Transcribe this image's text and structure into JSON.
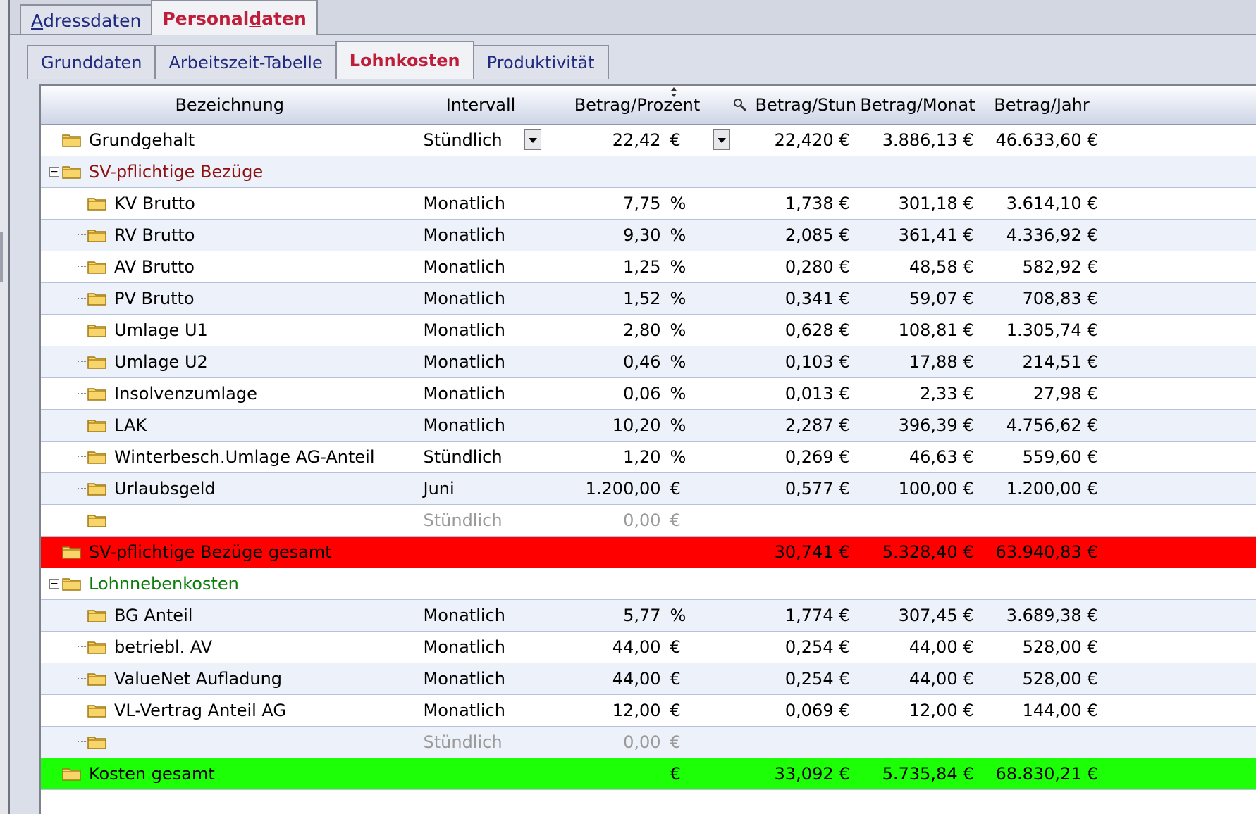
{
  "tabs_top": [
    {
      "pre": "",
      "ul": "A",
      "post": "dressdaten"
    },
    {
      "pre": "Personal",
      "ul": "d",
      "post": "aten"
    }
  ],
  "tabs_sub": [
    "Grunddaten",
    "Arbeitszeit-Tabelle",
    "Lohnkosten",
    "Produktivität"
  ],
  "columns": [
    "Bezeichnung",
    "Intervall",
    "Betrag/Prozent",
    "Betrag/Stunde",
    "Betrag/Monat",
    "Betrag/Jahr"
  ],
  "rows": [
    {
      "name": "Grundgehalt",
      "interval": "Stündlich",
      "amount": "22,42",
      "unit": "€",
      "hour": "22,420 €",
      "month": "3.886,13 €",
      "year": "46.633,60 €"
    },
    {
      "name": "SV-pflichtige Bezüge",
      "interval": "",
      "amount": "",
      "unit": "",
      "hour": "",
      "month": "",
      "year": ""
    },
    {
      "name": "KV Brutto",
      "interval": "Monatlich",
      "amount": "7,75",
      "unit": "%",
      "hour": "1,738 €",
      "month": "301,18 €",
      "year": "3.614,10 €"
    },
    {
      "name": "RV Brutto",
      "interval": "Monatlich",
      "amount": "9,30",
      "unit": "%",
      "hour": "2,085 €",
      "month": "361,41 €",
      "year": "4.336,92 €"
    },
    {
      "name": "AV Brutto",
      "interval": "Monatlich",
      "amount": "1,25",
      "unit": "%",
      "hour": "0,280 €",
      "month": "48,58 €",
      "year": "582,92 €"
    },
    {
      "name": "PV Brutto",
      "interval": "Monatlich",
      "amount": "1,52",
      "unit": "%",
      "hour": "0,341 €",
      "month": "59,07 €",
      "year": "708,83 €"
    },
    {
      "name": "Umlage U1",
      "interval": "Monatlich",
      "amount": "2,80",
      "unit": "%",
      "hour": "0,628 €",
      "month": "108,81 €",
      "year": "1.305,74 €"
    },
    {
      "name": "Umlage U2",
      "interval": "Monatlich",
      "amount": "0,46",
      "unit": "%",
      "hour": "0,103 €",
      "month": "17,88 €",
      "year": "214,51 €"
    },
    {
      "name": "Insolvenzumlage",
      "interval": "Monatlich",
      "amount": "0,06",
      "unit": "%",
      "hour": "0,013 €",
      "month": "2,33 €",
      "year": "27,98 €"
    },
    {
      "name": "LAK",
      "interval": "Monatlich",
      "amount": "10,20",
      "unit": "%",
      "hour": "2,287 €",
      "month": "396,39 €",
      "year": "4.756,62 €"
    },
    {
      "name": "Winterbesch.Umlage AG-Anteil",
      "interval": "Stündlich",
      "amount": "1,20",
      "unit": "%",
      "hour": "0,269 €",
      "month": "46,63 €",
      "year": "559,60 €"
    },
    {
      "name": "Urlaubsgeld",
      "interval": "Juni",
      "amount": "1.200,00",
      "unit": "€",
      "hour": "0,577 €",
      "month": "100,00 €",
      "year": "1.200,00 €"
    },
    {
      "name": "",
      "interval": "Stündlich",
      "amount": "0,00",
      "unit": "€",
      "hour": "",
      "month": "",
      "year": ""
    },
    {
      "name": "SV-pflichtige Bezüge gesamt",
      "interval": "",
      "amount": "",
      "unit": "",
      "hour": "30,741 €",
      "month": "5.328,40 €",
      "year": "63.940,83 €"
    },
    {
      "name": "Lohnnebenkosten",
      "interval": "",
      "amount": "",
      "unit": "",
      "hour": "",
      "month": "",
      "year": ""
    },
    {
      "name": "BG Anteil",
      "interval": "Monatlich",
      "amount": "5,77",
      "unit": "%",
      "hour": "1,774 €",
      "month": "307,45 €",
      "year": "3.689,38 €"
    },
    {
      "name": "betriebl. AV",
      "interval": "Monatlich",
      "amount": "44,00",
      "unit": "€",
      "hour": "0,254 €",
      "month": "44,00 €",
      "year": "528,00 €"
    },
    {
      "name": "ValueNet Aufladung",
      "interval": "Monatlich",
      "amount": "44,00",
      "unit": "€",
      "hour": "0,254 €",
      "month": "44,00 €",
      "year": "528,00 €"
    },
    {
      "name": "VL-Vertrag Anteil AG",
      "interval": "Monatlich",
      "amount": "12,00",
      "unit": "€",
      "hour": "0,069 €",
      "month": "12,00 €",
      "year": "144,00 €"
    },
    {
      "name": "",
      "interval": "Stündlich",
      "amount": "0,00",
      "unit": "€",
      "hour": "",
      "month": "",
      "year": ""
    },
    {
      "name": "Kosten gesamt",
      "interval": "",
      "amount": "",
      "unit": "€",
      "hour": "33,092 €",
      "month": "5.735,84 €",
      "year": "68.830,21 €"
    }
  ],
  "colors": {
    "total_red": "#ff0000",
    "total_green": "#1cff06",
    "group_red_text": "#8e1010",
    "group_green_text": "#0b7d0b"
  }
}
